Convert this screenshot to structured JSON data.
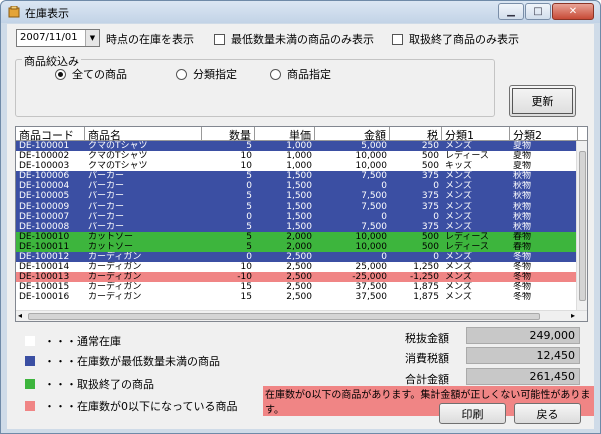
{
  "window": {
    "title": "在庫表示"
  },
  "controls": {
    "date_value": "2007/11/01",
    "date_suffix": "時点の在庫を表示",
    "chk_min_stock": "最低数量未満の商品のみ表示",
    "chk_discontinued": "取扱終了商品のみ表示",
    "filter_group_label": "商品絞込み",
    "radio_all": "全ての商品",
    "radio_category": "分類指定",
    "radio_product": "商品指定",
    "refresh_button": "更新"
  },
  "table": {
    "headers": [
      "商品コード",
      "商品名",
      "数量",
      "単価",
      "金額",
      "税",
      "分類1",
      "分類2"
    ],
    "rows": [
      {
        "code": "DE-100001",
        "name": "クマのTシャツ",
        "qty": "5",
        "price": "1,000",
        "amount": "5,000",
        "tax": "250",
        "cat1": "メンズ",
        "cat2": "夏物",
        "style": "blue"
      },
      {
        "code": "DE-100002",
        "name": "クマのTシャツ",
        "qty": "10",
        "price": "1,000",
        "amount": "10,000",
        "tax": "500",
        "cat1": "レディース",
        "cat2": "夏物",
        "style": "normal"
      },
      {
        "code": "DE-100003",
        "name": "クマのTシャツ",
        "qty": "10",
        "price": "1,000",
        "amount": "10,000",
        "tax": "500",
        "cat1": "キッズ",
        "cat2": "夏物",
        "style": "normal"
      },
      {
        "code": "DE-100006",
        "name": "パーカー",
        "qty": "5",
        "price": "1,500",
        "amount": "7,500",
        "tax": "375",
        "cat1": "メンズ",
        "cat2": "秋物",
        "style": "blue"
      },
      {
        "code": "DE-100004",
        "name": "パーカー",
        "qty": "0",
        "price": "1,500",
        "amount": "0",
        "tax": "0",
        "cat1": "メンズ",
        "cat2": "秋物",
        "style": "blue"
      },
      {
        "code": "DE-100005",
        "name": "パーカー",
        "qty": "5",
        "price": "1,500",
        "amount": "7,500",
        "tax": "375",
        "cat1": "メンズ",
        "cat2": "秋物",
        "style": "blue"
      },
      {
        "code": "DE-100009",
        "name": "パーカー",
        "qty": "5",
        "price": "1,500",
        "amount": "7,500",
        "tax": "375",
        "cat1": "メンズ",
        "cat2": "秋物",
        "style": "blue"
      },
      {
        "code": "DE-100007",
        "name": "パーカー",
        "qty": "0",
        "price": "1,500",
        "amount": "0",
        "tax": "0",
        "cat1": "メンズ",
        "cat2": "秋物",
        "style": "blue"
      },
      {
        "code": "DE-100008",
        "name": "パーカー",
        "qty": "5",
        "price": "1,500",
        "amount": "7,500",
        "tax": "375",
        "cat1": "メンズ",
        "cat2": "秋物",
        "style": "blue"
      },
      {
        "code": "DE-100010",
        "name": "カットソー",
        "qty": "5",
        "price": "2,000",
        "amount": "10,000",
        "tax": "500",
        "cat1": "レディース",
        "cat2": "春物",
        "style": "green"
      },
      {
        "code": "DE-100011",
        "name": "カットソー",
        "qty": "5",
        "price": "2,000",
        "amount": "10,000",
        "tax": "500",
        "cat1": "レディース",
        "cat2": "春物",
        "style": "green"
      },
      {
        "code": "DE-100012",
        "name": "カーディガン",
        "qty": "0",
        "price": "2,500",
        "amount": "0",
        "tax": "0",
        "cat1": "メンズ",
        "cat2": "冬物",
        "style": "blue"
      },
      {
        "code": "DE-100014",
        "name": "カーディガン",
        "qty": "10",
        "price": "2,500",
        "amount": "25,000",
        "tax": "1,250",
        "cat1": "メンズ",
        "cat2": "冬物",
        "style": "normal"
      },
      {
        "code": "DE-100013",
        "name": "カーディガン",
        "qty": "-10",
        "price": "2,500",
        "amount": "-25,000",
        "tax": "-1,250",
        "cat1": "メンズ",
        "cat2": "冬物",
        "style": "red"
      },
      {
        "code": "DE-100015",
        "name": "カーディガン",
        "qty": "15",
        "price": "2,500",
        "amount": "37,500",
        "tax": "1,875",
        "cat1": "メンズ",
        "cat2": "冬物",
        "style": "normal"
      },
      {
        "code": "DE-100016",
        "name": "カーディガン",
        "qty": "15",
        "price": "2,500",
        "amount": "37,500",
        "tax": "1,875",
        "cat1": "メンズ",
        "cat2": "冬物",
        "style": "normal"
      }
    ]
  },
  "legend": {
    "normal": "・・・通常在庫",
    "below_min": "・・・在庫数が最低数量未満の商品",
    "discontinued": "・・・取扱終了の商品",
    "negative": "・・・在庫数が0以下になっている商品"
  },
  "totals": {
    "pretax_label": "税抜金額",
    "pretax_value": "249,000",
    "tax_label": "消費税額",
    "tax_value": "12,450",
    "total_label": "合計金額",
    "total_value": "261,450"
  },
  "warning": "在庫数が0以下の商品があります。集計金額が正しくない可能性があります。",
  "buttons": {
    "print": "印刷",
    "back": "戻る"
  },
  "colors": {
    "blue": "#3b4fa3",
    "green": "#3db53d",
    "red": "#f08585",
    "normal": "#ffffff"
  }
}
